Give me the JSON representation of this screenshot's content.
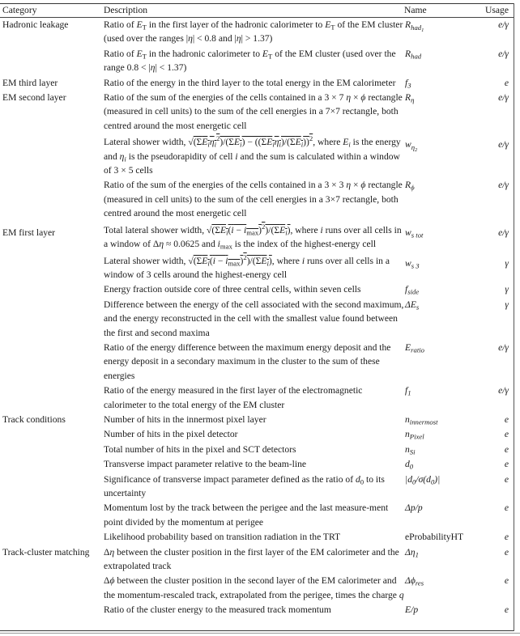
{
  "table": {
    "headers": {
      "category": "Category",
      "description": "Description",
      "name": "Name",
      "usage": "Usage"
    },
    "rows": [
      {
        "category": "Hadronic leakage",
        "description": "Ratio of E_T in the first layer of the hadronic calorimeter to E_T of the EM cluster (used over the ranges |η| < 0.8 and |η| > 1.37)",
        "name": "R_had1",
        "usage": "e/γ"
      },
      {
        "category": "",
        "description": "Ratio of E_T in the hadronic calorimeter to E_T of the EM cluster (used over the range 0.8 < |η| < 1.37)",
        "name": "R_had",
        "usage": "e/γ"
      },
      {
        "category": "EM third layer",
        "description": "Ratio of the energy in the third layer to the total energy in the EM calorimeter",
        "name": "f_3",
        "usage": "e"
      },
      {
        "category": "EM second layer",
        "description": "Ratio of the sum of the energies of the cells contained in a 3 × 7 η × ϕ rectangle (measured in cell units) to the sum of the cell energies in a 7×7 rectangle, both centred around the most energetic cell",
        "name": "R_η",
        "usage": "e/γ"
      },
      {
        "category": "",
        "description": "Lateral shower width, √((ΣE_iη_i²)/(ΣE_i) − ((ΣE_iη_i)/(ΣE_i))²), where E_i is the energy and η_i is the pseudorapidity of cell i and the sum is calculated within a window of 3 × 5 cells",
        "name": "w_η2",
        "usage": "e/γ"
      },
      {
        "category": "",
        "description": "Ratio of the sum of the energies of the cells contained in a 3 × 3 η × ϕ rectangle (measured in cell units) to the sum of the cell energies in a 3×7 rectangle, both centred around the most energetic cell",
        "name": "R_ϕ",
        "usage": "e/γ"
      },
      {
        "category": "EM first layer",
        "description": "Total lateral shower width, √((ΣE_i(i − i_max)²)/(ΣE_i)), where i runs over all cells in a window of Δη ≈ 0.0625 and i_max is the index of the highest-energy cell",
        "name": "w_s tot",
        "usage": "e/γ"
      },
      {
        "category": "",
        "description": "Lateral shower width, √((ΣE_i(i − i_max)²)/(ΣE_i)), where i runs over all cells in a window of 3 cells around the highest-energy cell",
        "name": "w_s 3",
        "usage": "γ"
      },
      {
        "category": "",
        "description": "Energy fraction outside core of three central cells, within seven cells",
        "name": "f_side",
        "usage": "γ"
      },
      {
        "category": "",
        "description": "Difference between the energy of the cell associated with the second maximum, and the energy reconstructed in the cell with the smallest value found between the first and second maxima",
        "name": "ΔE_s",
        "usage": "γ"
      },
      {
        "category": "",
        "description": "Ratio of the energy difference between the maximum energy deposit and the energy deposit in a secondary maximum in the cluster to the sum of these energies",
        "name": "E_ratio",
        "usage": "e/γ"
      },
      {
        "category": "",
        "description": "Ratio of the energy measured in the first layer of the electromagnetic calorimeter to the total energy of the EM cluster",
        "name": "f_1",
        "usage": "e/γ"
      },
      {
        "category": "Track conditions",
        "description": "Number of hits in the innermost pixel layer",
        "name": "n_innermost",
        "usage": "e"
      },
      {
        "category": "",
        "description": "Number of hits in the pixel detector",
        "name": "n_Pixel",
        "usage": "e"
      },
      {
        "category": "",
        "description": "Total number of hits in the pixel and SCT detectors",
        "name": "n_Si",
        "usage": "e"
      },
      {
        "category": "",
        "description": "Transverse impact parameter relative to the beam-line",
        "name": "d_0",
        "usage": "e"
      },
      {
        "category": "",
        "description": "Significance of transverse impact parameter defined as the ratio of d_0 to its uncertainty",
        "name": "|d_0/σ(d_0)|",
        "usage": "e"
      },
      {
        "category": "",
        "description": "Momentum lost by the track between the perigee and the last measurement point divided by the momentum at perigee",
        "name": "Δp/p",
        "usage": "e"
      },
      {
        "category": "",
        "description": "Likelihood probability based on transition radiation in the TRT",
        "name": "eProbabilityHT",
        "usage": "e"
      },
      {
        "category": "Track-cluster matching",
        "description": "Δη between the cluster position in the first layer of the EM calorimeter and the extrapolated track",
        "name": "Δη_1",
        "usage": "e"
      },
      {
        "category": "",
        "description": "Δϕ between the cluster position in the second layer of the EM calorimeter and the momentum-rescaled track, extrapolated from the perigee, times the charge q",
        "name": "Δϕ_res",
        "usage": "e"
      },
      {
        "category": "",
        "description": "Ratio of the cluster energy to the measured track momentum",
        "name": "E/p",
        "usage": "e"
      }
    ]
  }
}
